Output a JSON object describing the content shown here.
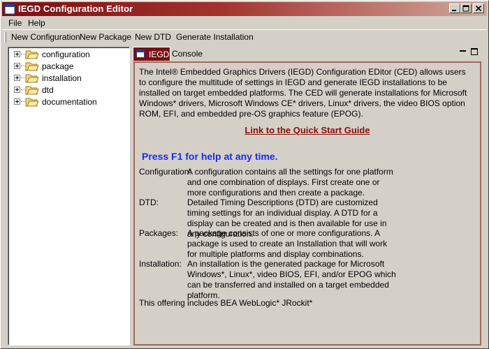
{
  "window": {
    "title": "IEGD Configuration Editor"
  },
  "menu": {
    "items": [
      "File",
      "Help"
    ]
  },
  "toolbar": {
    "items": [
      "New Configuration",
      "New Package",
      "New DTD",
      "Generate Installation"
    ]
  },
  "tree": {
    "items": [
      "configuration",
      "package",
      "installation",
      "dtd",
      "documentation"
    ]
  },
  "tabs": {
    "active": "IEGD",
    "other": "Console"
  },
  "content": {
    "intro": "The Intel® Embedded Graphics Drivers (IEGD) Configuration EDitor (CED) allows users to configure the multitude of settings in IEGD and generate IEGD installations to be installed on target embedded platforms.  The CED will generate installations for Microsoft Windows* drivers, Microsoft Windows CE* drivers, Linux* drivers, the video BIOS option ROM, EFI, and embedded pre-OS graphics feature (EPOG).",
    "link": "Link to the Quick Start Guide",
    "help_hint": "Press F1 for help at any time.",
    "definitions": [
      {
        "term": "Configuration:",
        "desc": "A configuration contains all the settings for one platform and one combination of displays.  First create one or more configurations and then create a package."
      },
      {
        "term": "DTD:",
        "desc": "Detailed Timing Descriptions (DTD) are customized timing settings for an individual display.  A DTD for a display can be created and is then available for use in any configuration."
      },
      {
        "term": "Packages:",
        "desc": "A package consists of one or more configurations.  A package is used to create an Installation that will work for multiple platforms and display combinations."
      },
      {
        "term": "Installation:",
        "desc": "An installation is the generated package for Microsoft Windows*, Linux*, video BIOS, EFI, and/or EPOG which can be transferred and installed on a target embedded platform."
      }
    ],
    "footer": "This offering includes BEA WebLogic* JRockit*"
  },
  "colors": {
    "titlebar_start": "#7a0f12",
    "link": "#8b0d0d",
    "help_hint": "#1a2cf0",
    "tab_active": "#7a0f12"
  }
}
